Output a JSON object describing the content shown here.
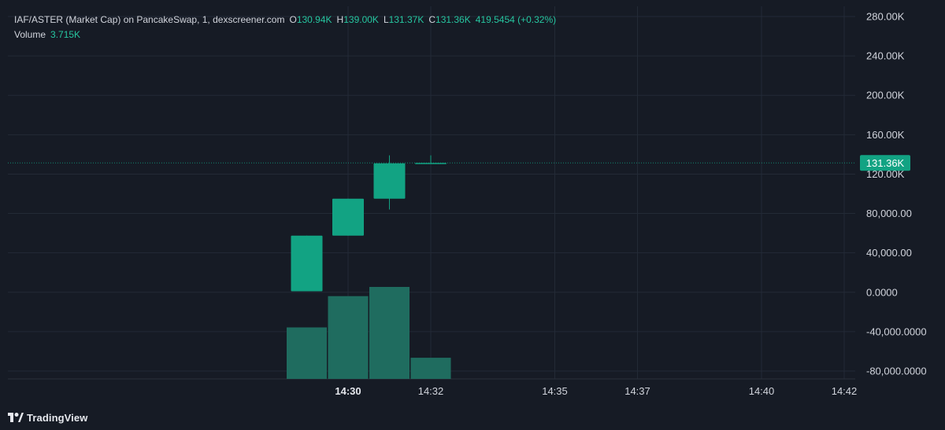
{
  "legend": {
    "title": "IAF/ASTER (Market Cap) on PancakeSwap, 1, dexscreener.com",
    "o_key": "O",
    "o_val": "130.94K",
    "h_key": "H",
    "h_val": "139.00K",
    "l_key": "L",
    "l_val": "131.37K",
    "c_key": "C",
    "c_val": "131.36K",
    "change": "419.5454 (+0.32%)",
    "volume_label": "Volume",
    "volume_val": "3.715K"
  },
  "footer": {
    "brand": "TradingView",
    "logo_icon": "tradingview-logo-icon"
  },
  "colors": {
    "background": "#161b25",
    "up": "#12a383",
    "volume": "#1f6c5f",
    "grid": "#232a36",
    "text": "#d1d4dc",
    "accent": "#26c6a0",
    "price_tag": "#12a383"
  },
  "chart_data": {
    "type": "candlestick",
    "price_axis": {
      "ticks": [
        {
          "value": 280000,
          "label": "280.00K"
        },
        {
          "value": 240000,
          "label": "240.00K"
        },
        {
          "value": 200000,
          "label": "200.00K"
        },
        {
          "value": 160000,
          "label": "160.00K"
        },
        {
          "value": 120000,
          "label": "120.00K"
        },
        {
          "value": 80000,
          "label": "80,000.00"
        },
        {
          "value": 40000,
          "label": "40,000.00"
        },
        {
          "value": 0,
          "label": "0.0000"
        },
        {
          "value": -40000,
          "label": "-40,000.0000"
        },
        {
          "value": -80000,
          "label": "-80,000.0000"
        }
      ],
      "last_price_label": "131.36K",
      "last_price": 131360
    },
    "time_axis": {
      "ticks": [
        {
          "t": 0,
          "label": "14:30",
          "bold": true
        },
        {
          "t": 2,
          "label": "14:32",
          "bold": false
        },
        {
          "t": 5,
          "label": "14:35",
          "bold": false
        },
        {
          "t": 7,
          "label": "14:37",
          "bold": false
        },
        {
          "t": 10,
          "label": "14:40",
          "bold": false
        },
        {
          "t": 12,
          "label": "14:42",
          "bold": false
        }
      ]
    },
    "candles": [
      {
        "t": -1,
        "open": 1000,
        "high": 57500,
        "low": 1000,
        "close": 57500
      },
      {
        "t": 0,
        "open": 57500,
        "high": 95000,
        "low": 57500,
        "close": 95000
      },
      {
        "t": 1,
        "open": 95000,
        "high": 139000,
        "low": 84000,
        "close": 130940
      },
      {
        "t": 2,
        "open": 130940,
        "high": 139000,
        "low": 131370,
        "close": 131360
      }
    ],
    "volume": [
      {
        "t": -1,
        "value": 0.56
      },
      {
        "t": 0,
        "value": 0.9
      },
      {
        "t": 1,
        "value": 1.0
      },
      {
        "t": 2,
        "value": 0.23
      }
    ]
  }
}
